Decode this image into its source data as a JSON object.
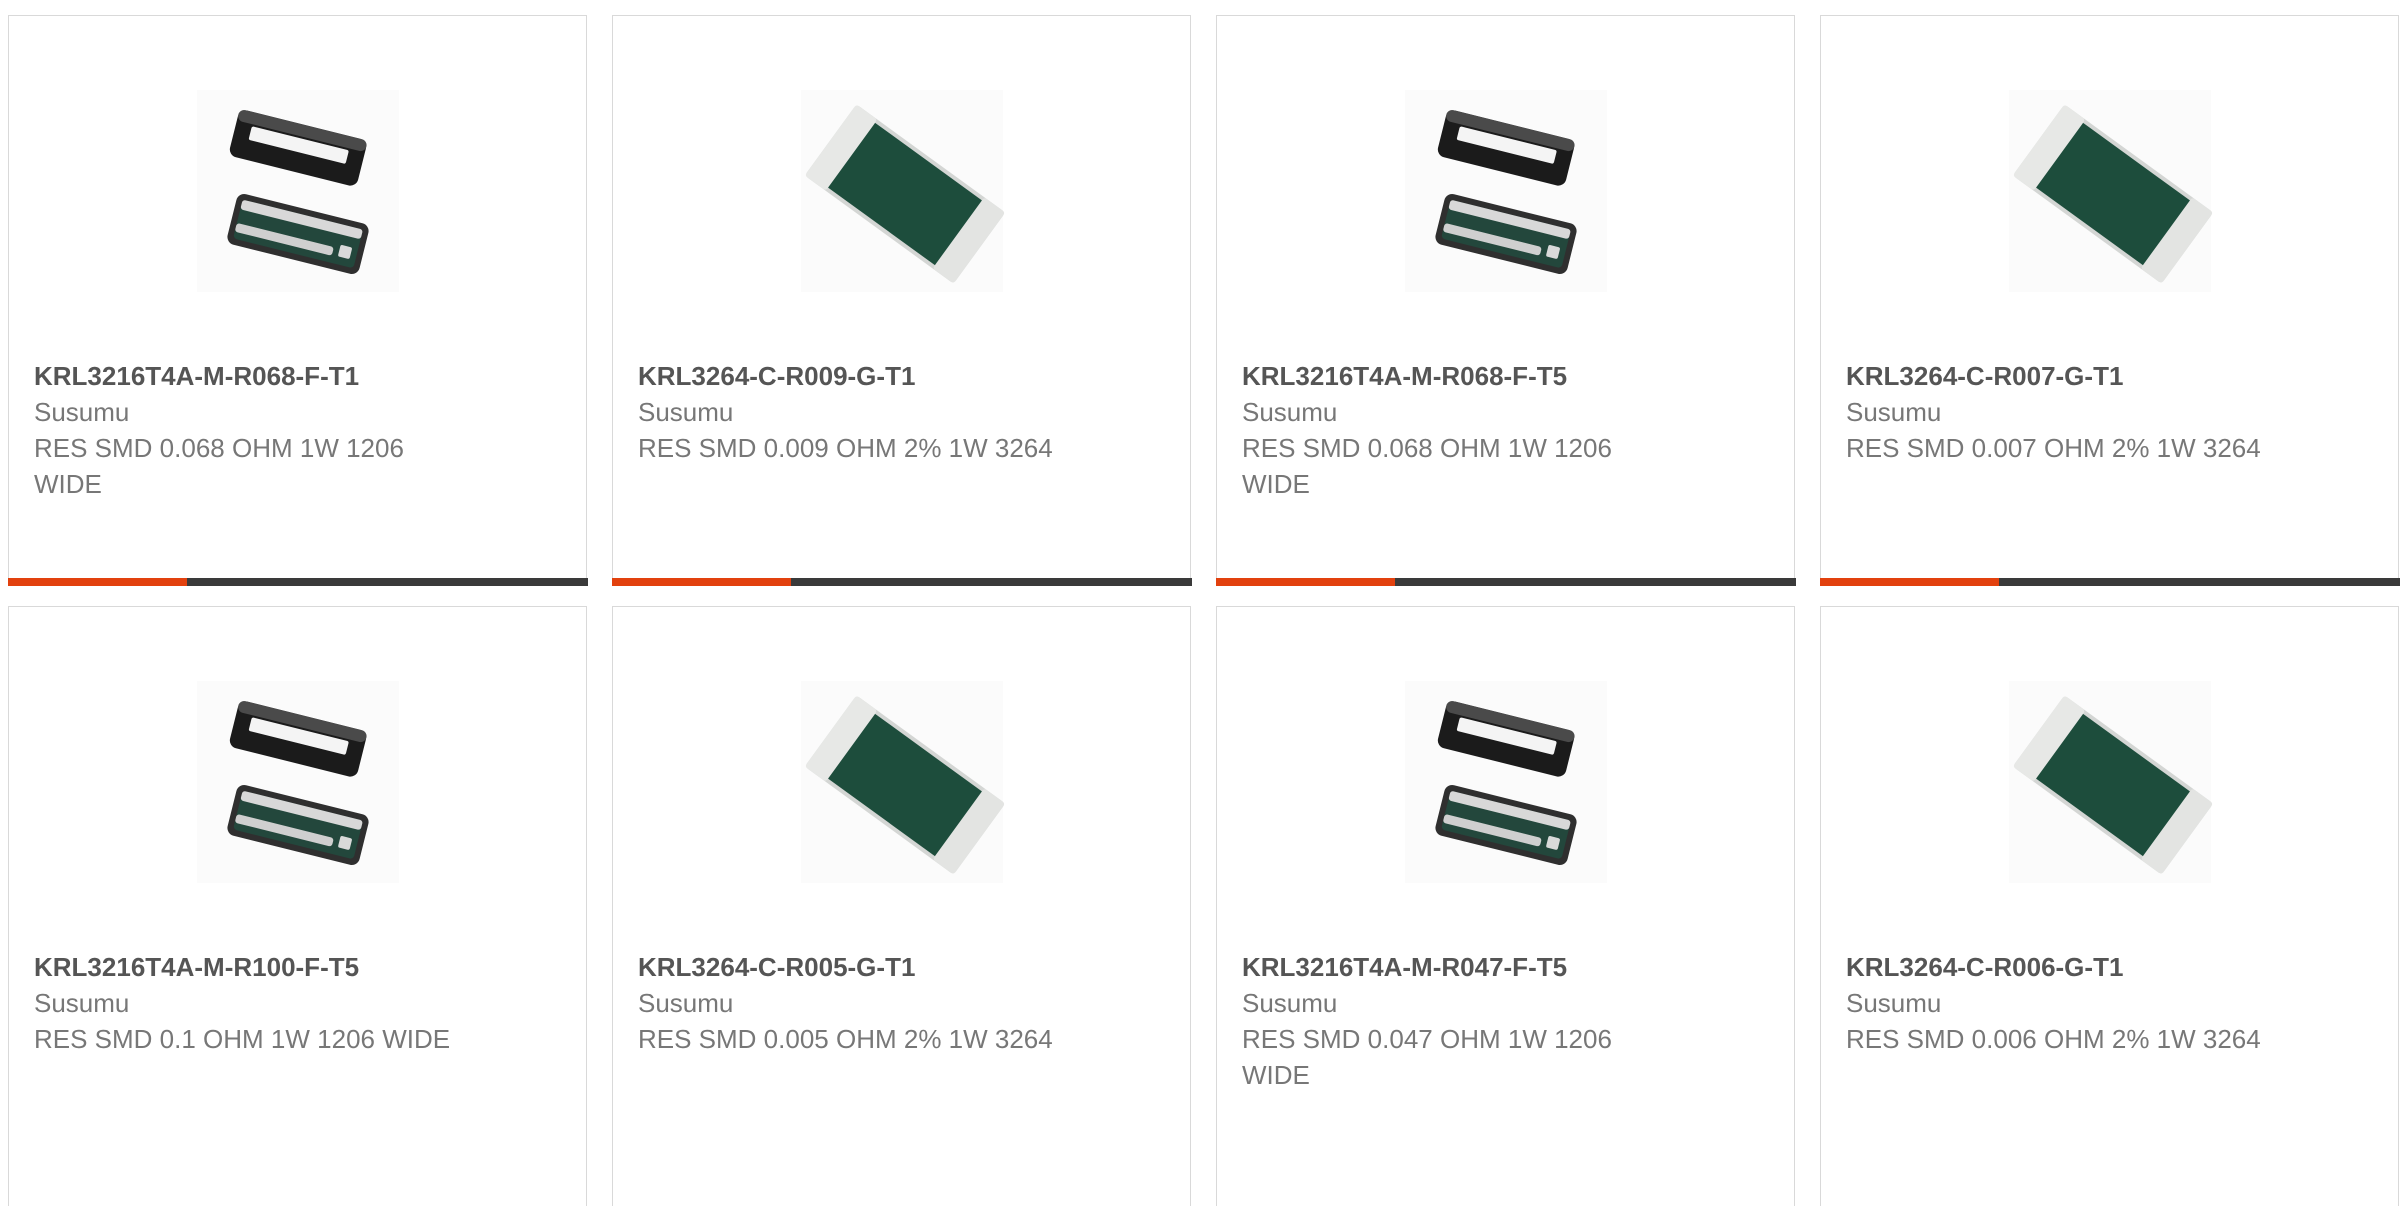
{
  "colors": {
    "accent": "#e2410e",
    "track": "#3a3a3a",
    "text": "#666666",
    "border": "#d9d9d9"
  },
  "products": [
    {
      "part_number": "KRL3216T4A-M-R068-F-T1",
      "manufacturer": "Susumu",
      "description": "RES SMD 0.068 OHM 1W 1206 WIDE",
      "image_icon": "split-resistor-pair-icon",
      "progress": 0.31
    },
    {
      "part_number": "KRL3264-C-R009-G-T1",
      "manufacturer": "Susumu",
      "description": "RES SMD 0.009 OHM 2% 1W 3264",
      "image_icon": "chip-resistor-icon",
      "progress": 0.31
    },
    {
      "part_number": "KRL3216T4A-M-R068-F-T5",
      "manufacturer": "Susumu",
      "description": "RES SMD 0.068 OHM 1W 1206 WIDE",
      "image_icon": "split-resistor-pair-icon",
      "progress": 0.31
    },
    {
      "part_number": "KRL3264-C-R007-G-T1",
      "manufacturer": "Susumu",
      "description": "RES SMD 0.007 OHM 2% 1W 3264",
      "image_icon": "chip-resistor-icon",
      "progress": 0.31
    },
    {
      "part_number": "KRL3216T4A-M-R100-F-T5",
      "manufacturer": "Susumu",
      "description": "RES SMD 0.1 OHM 1W 1206 WIDE",
      "image_icon": "split-resistor-pair-icon"
    },
    {
      "part_number": "KRL3264-C-R005-G-T1",
      "manufacturer": "Susumu",
      "description": "RES SMD 0.005 OHM 2% 1W 3264",
      "image_icon": "chip-resistor-icon"
    },
    {
      "part_number": "KRL3216T4A-M-R047-F-T5",
      "manufacturer": "Susumu",
      "description": "RES SMD 0.047 OHM 1W 1206 WIDE",
      "image_icon": "split-resistor-pair-icon"
    },
    {
      "part_number": "KRL3264-C-R006-G-T1",
      "manufacturer": "Susumu",
      "description": "RES SMD 0.006 OHM 2% 1W 3264",
      "image_icon": "chip-resistor-icon"
    }
  ]
}
